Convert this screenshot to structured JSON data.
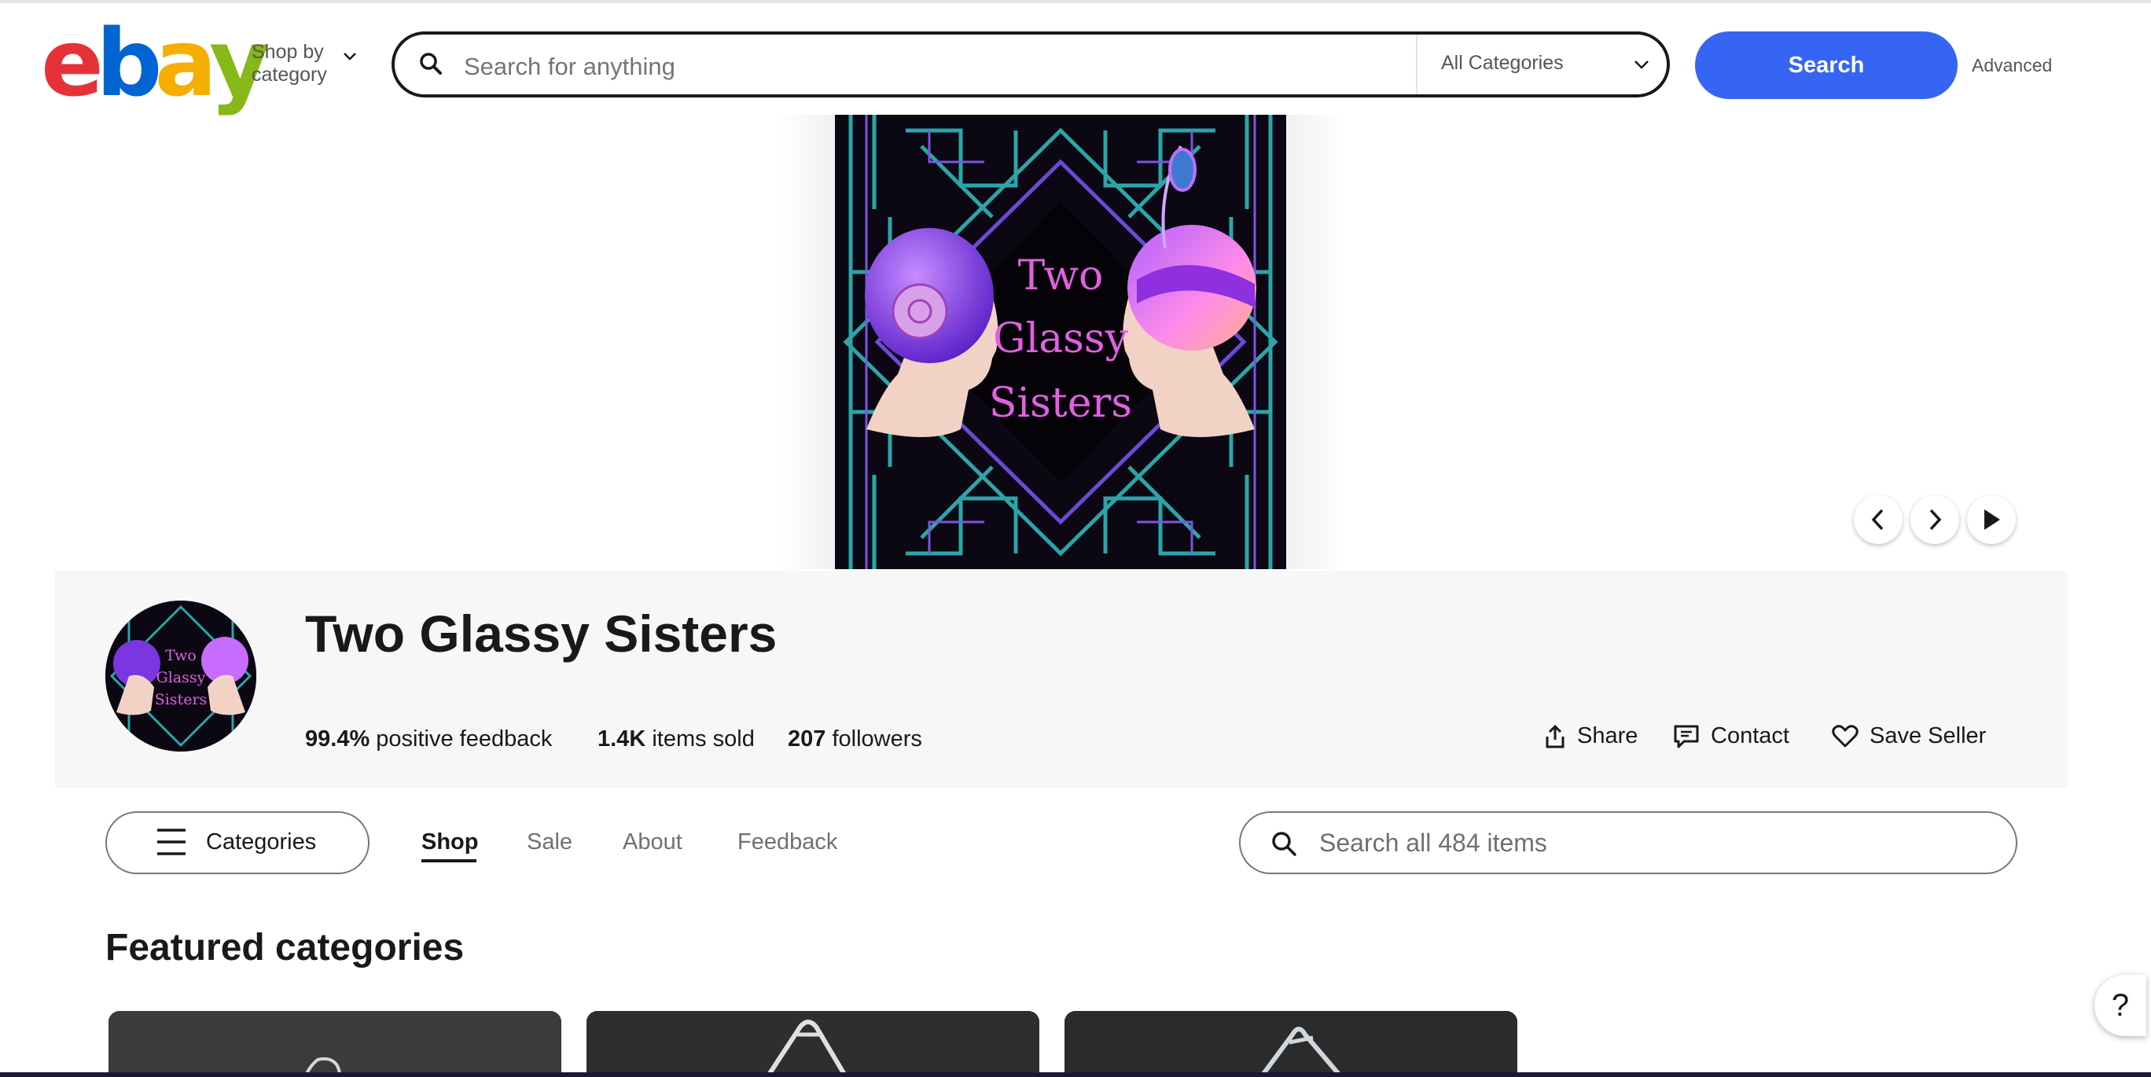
{
  "header": {
    "logo": [
      "e",
      "b",
      "a",
      "y"
    ],
    "logo_colors": [
      "#e53238",
      "#0064d2",
      "#f5af02",
      "#86b817"
    ],
    "shop_by_category": "Shop by category",
    "search_placeholder": "Search for anything",
    "category_select": "All Categories",
    "search_button": "Search",
    "advanced_link": "Advanced"
  },
  "billboard": {
    "line1": "Two",
    "line2": "Glassy",
    "line3": "Sisters",
    "controls": [
      "chevron-left-icon",
      "chevron-right-icon",
      "play-icon"
    ]
  },
  "store": {
    "name": "Two Glassy Sisters",
    "avatar_lines": [
      "Two",
      "Glassy",
      "Sisters"
    ],
    "feedback_value": "99.4%",
    "feedback_label": "positive feedback",
    "sold_value": "1.4K",
    "sold_label": "items sold",
    "followers_value": "207",
    "followers_label": "followers",
    "actions": {
      "share": "Share",
      "contact": "Contact",
      "save": "Save Seller"
    }
  },
  "nav": {
    "categories_button": "Categories",
    "tabs": [
      "Shop",
      "Sale",
      "About",
      "Feedback"
    ],
    "active_tab": "Shop",
    "store_search_placeholder": "Search all 484 items"
  },
  "featured": {
    "title": "Featured categories"
  },
  "help_label": "?",
  "colors": {
    "accent": "#3665f3",
    "band": "#f7f7f7",
    "text": "#191919",
    "muted": "#707070",
    "art_purple": "#a64bf4",
    "art_teal": "#2aa6a8",
    "art_pink": "#e060e0"
  }
}
